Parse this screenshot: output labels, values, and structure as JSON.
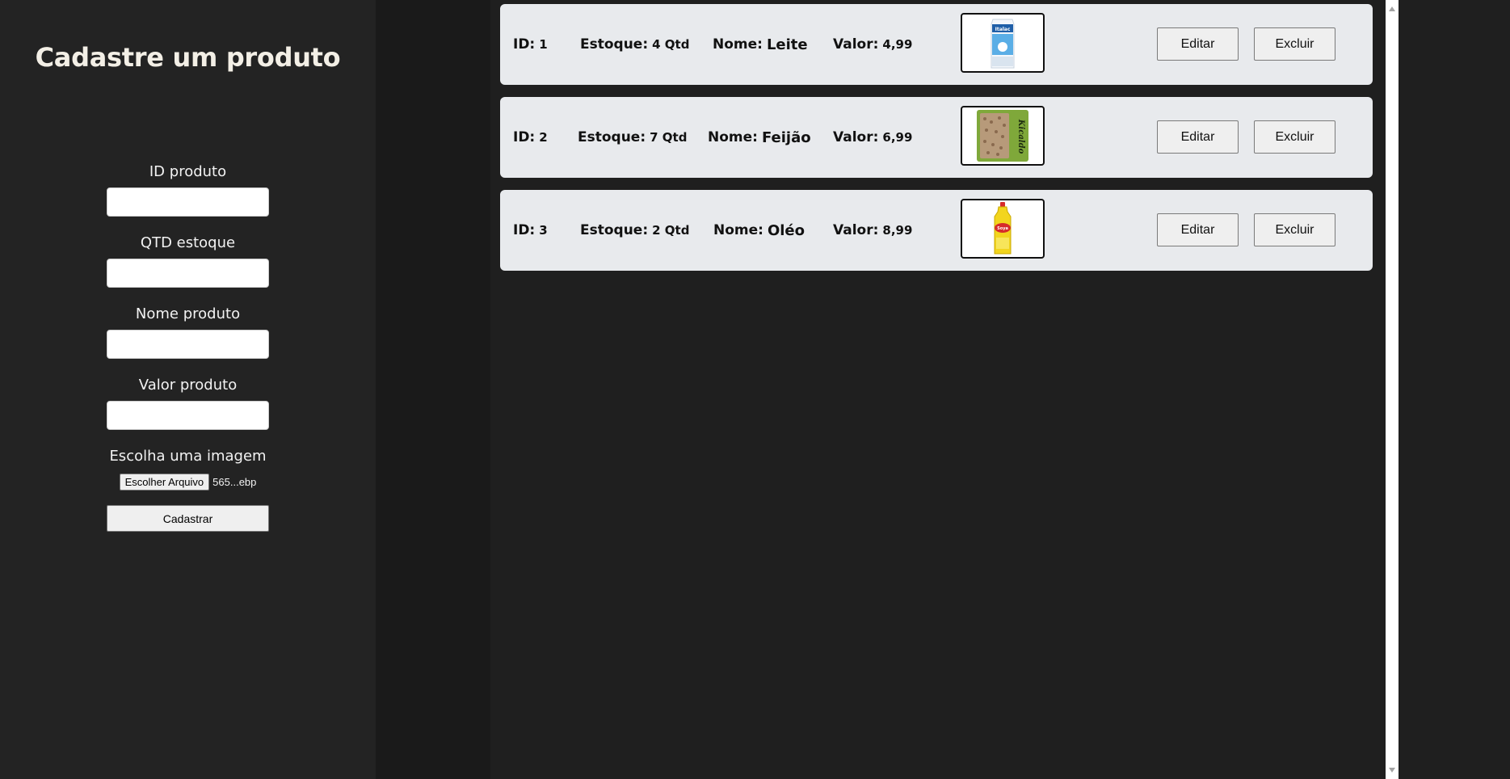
{
  "form": {
    "title": "Cadastre um produto",
    "id_label": "ID produto",
    "qtd_label": "QTD estoque",
    "nome_label": "Nome produto",
    "valor_label": "Valor produto",
    "imagem_label": "Escolha uma imagem",
    "file_button": "Escolher Arquivo",
    "file_name": "565...ebp",
    "submit": "Cadastrar"
  },
  "products": [
    {
      "id_key": "ID:",
      "id": "1",
      "estoque_key": "Estoque:",
      "estoque": "4 Qtd",
      "nome_key": "Nome:",
      "nome": "Leite",
      "valor_key": "Valor:",
      "valor": "4,99",
      "image_icon": "milk-carton-image",
      "image_text": "Italac",
      "edit": "Editar",
      "delete": "Excluir"
    },
    {
      "id_key": "ID:",
      "id": "2",
      "estoque_key": "Estoque:",
      "estoque": "7 Qtd",
      "nome_key": "Nome:",
      "nome": "Feijão",
      "valor_key": "Valor:",
      "valor": "6,99",
      "image_icon": "bean-package-image",
      "image_text": "Kicaldo",
      "edit": "Editar",
      "delete": "Excluir"
    },
    {
      "id_key": "ID:",
      "id": "3",
      "estoque_key": "Estoque:",
      "estoque": "2 Qtd",
      "nome_key": "Nome:",
      "nome": "Oléo",
      "valor_key": "Valor:",
      "valor": "8,99",
      "image_icon": "oil-bottle-image",
      "image_text": "Soya",
      "edit": "Editar",
      "delete": "Excluir"
    }
  ],
  "colors": {
    "sidebar": "#232323",
    "background": "#1f1f1f",
    "card": "#e8eaed",
    "title": "#f3efe6"
  }
}
